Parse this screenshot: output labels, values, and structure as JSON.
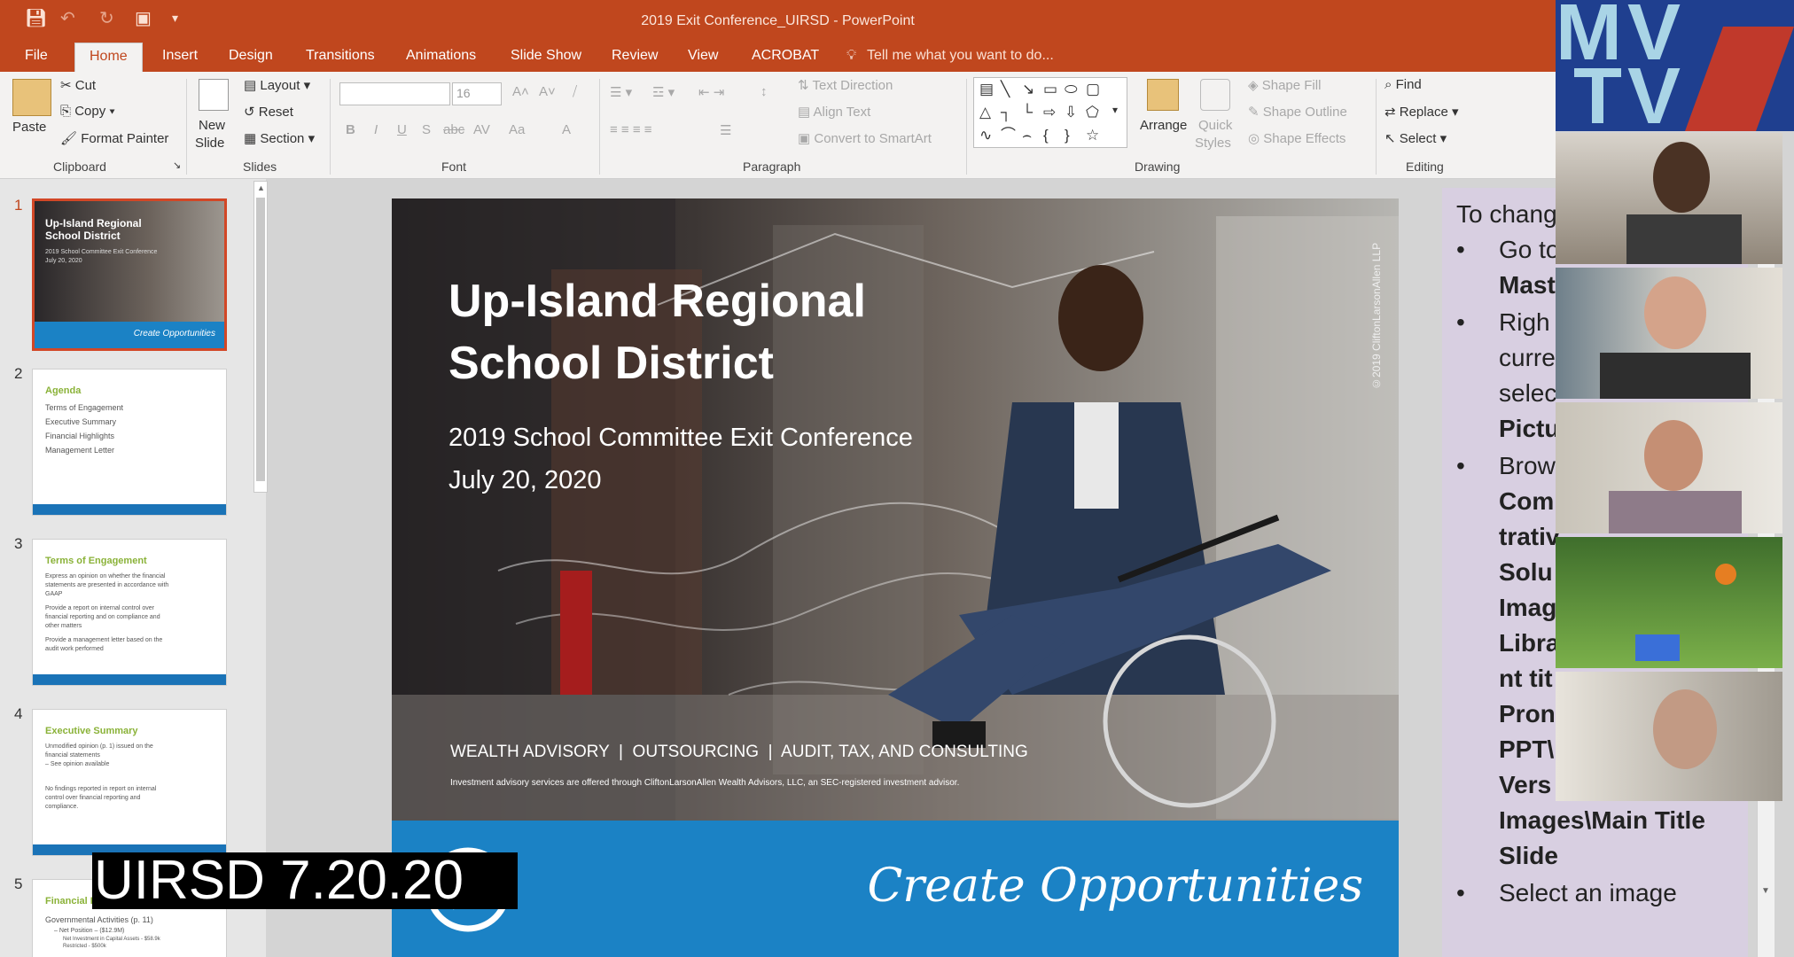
{
  "window": {
    "title": "2019 Exit Conference_UIRSD - PowerPoint"
  },
  "tabs": [
    "File",
    "Home",
    "Insert",
    "Design",
    "Transitions",
    "Animations",
    "Slide Show",
    "Review",
    "View",
    "ACROBAT"
  ],
  "tell_me": "Tell me what you want to do...",
  "ribbon": {
    "clipboard": {
      "paste": "Paste",
      "cut": "Cut",
      "copy": "Copy",
      "format_painter": "Format Painter",
      "label": "Clipboard"
    },
    "slides": {
      "new_slide": "New",
      "new_slide2": "Slide",
      "layout": "Layout",
      "reset": "Reset",
      "section": "Section",
      "label": "Slides"
    },
    "font": {
      "font_size": "16",
      "label": "Font",
      "bold": "B",
      "italic": "I",
      "underline": "U",
      "shadow": "S",
      "strike": "abc",
      "spacing": "AV",
      "case": "Aa",
      "color": "A"
    },
    "paragraph": {
      "text_direction": "Text Direction",
      "align_text": "Align Text",
      "smartart": "Convert to SmartArt",
      "label": "Paragraph"
    },
    "drawing": {
      "arrange": "Arrange",
      "quick_styles": "Quick",
      "quick_styles2": "Styles",
      "shape_fill": "Shape Fill",
      "shape_outline": "Shape Outline",
      "shape_effects": "Shape Effects",
      "label": "Drawing"
    },
    "editing": {
      "find": "Find",
      "replace": "Replace",
      "select": "Select",
      "label": "Editing"
    }
  },
  "thumbnails": [
    {
      "num": "1",
      "title": "Up-Island Regional School District",
      "lines": [
        "2019 School Committee Exit Conference",
        "July 20, 2020"
      ],
      "footer": "Create Opportunities"
    },
    {
      "num": "2",
      "title": "Agenda",
      "lines": [
        "Terms of Engagement",
        "Executive Summary",
        "Financial Highlights",
        "Management Letter"
      ]
    },
    {
      "num": "3",
      "title": "Terms of Engagement",
      "lines": [
        "Express an opinion on whether the financial",
        "statements are presented in accordance with",
        "GAAP",
        "Provide a report on internal control over",
        "financial reporting and on compliance and",
        "other matters",
        "Provide a management letter based on the",
        "audit work performed"
      ]
    },
    {
      "num": "4",
      "title": "Executive Summary",
      "lines": [
        "Unmodified opinion (p. 1) issued on the",
        "financial statements",
        "– See opinion available",
        "No findings reported in report on internal",
        "control over financial reporting and",
        "compliance."
      ]
    },
    {
      "num": "5",
      "title": "Financial H",
      "lines": [
        "Governmental Activities (p. 11)",
        "– Net Position – ($12.9M)",
        "Net Investment in Capital Assets - $58.9k",
        "Restricted - $500k"
      ]
    }
  ],
  "slide": {
    "title_line1": "Up-Island Regional",
    "title_line2": "School District",
    "subtitle": "2019 School Committee Exit Conference",
    "date": "July 20, 2020",
    "services": "WEALTH ADVISORY  |  OUTSOURCING  |  AUDIT, TAX, AND CONSULTING",
    "disclaimer": "Investment advisory services are offered through CliftonLarsonAllen Wealth Advisors, LLC, an SEC-registered investment advisor.",
    "copyright": "©2019 CliftonLarsonAllen LLP",
    "tagline": "Create Opportunities"
  },
  "notes": {
    "heading": "To chang",
    "bullets": [
      {
        "lines": [
          "Go to",
          "Mast"
        ]
      },
      {
        "lines": [
          "Righ",
          "curre",
          "selec",
          "Pictu"
        ]
      },
      {
        "lines": [
          "Brow",
          "Com",
          "trativ",
          "Solu",
          "Imag",
          "Libra",
          "nt tit",
          "Pron",
          "PPT\\",
          "Vers",
          "Images\\Main Title",
          "Slide"
        ]
      },
      {
        "lines": [
          "Select an image"
        ]
      }
    ]
  },
  "logo": {
    "line1": "MV",
    "line2": "TV"
  },
  "caption": "UIRSD 7.20.20",
  "colors": {
    "accent": "#c0471e",
    "slide_blue": "#1b82c5",
    "thumb_green": "#8ab238",
    "notes_bg": "#d8cfe1"
  }
}
